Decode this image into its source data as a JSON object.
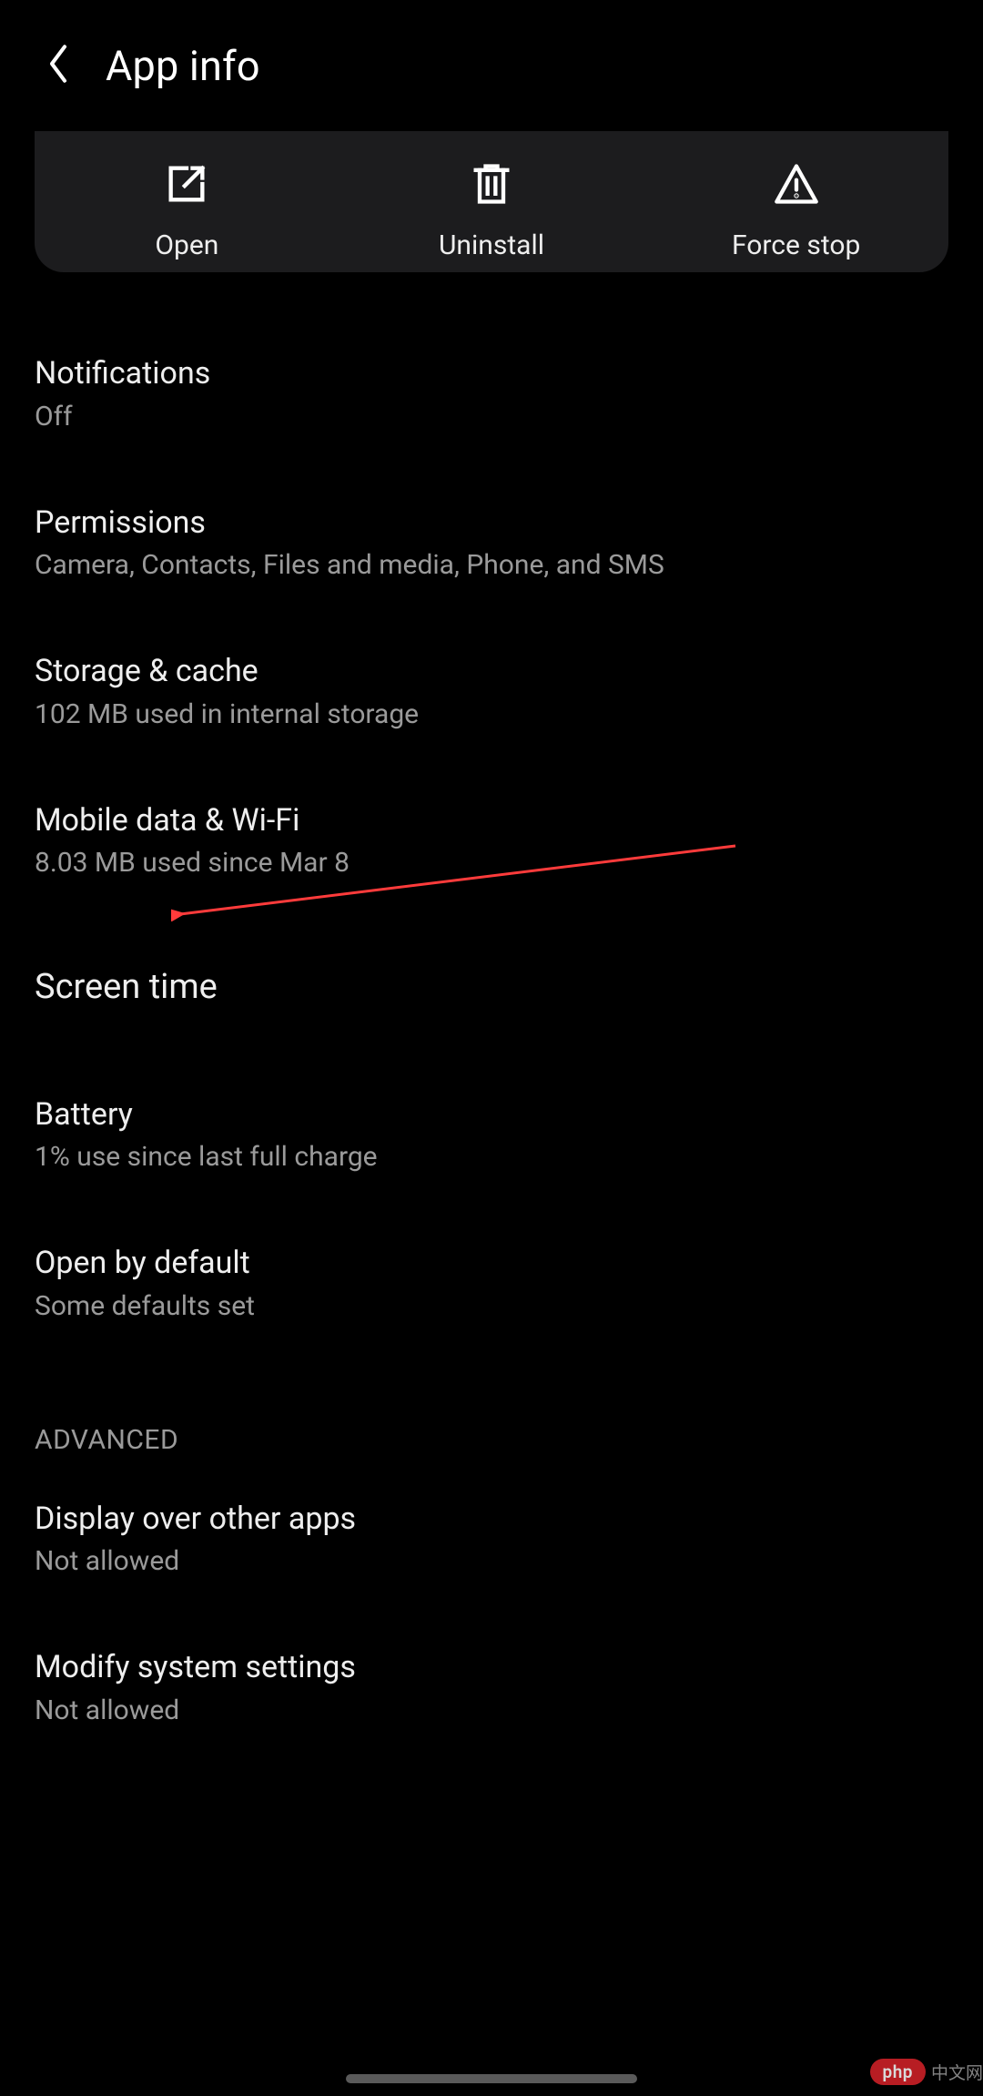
{
  "header": {
    "title": "App info"
  },
  "actions": {
    "open": "Open",
    "uninstall": "Uninstall",
    "force_stop": "Force stop"
  },
  "items": {
    "notifications": {
      "title": "Notifications",
      "sub": "Off"
    },
    "permissions": {
      "title": "Permissions",
      "sub": "Camera, Contacts, Files and media, Phone, and SMS"
    },
    "storage": {
      "title": "Storage & cache",
      "sub": "102 MB used in internal storage"
    },
    "mobile_data": {
      "title": "Mobile data & Wi-Fi",
      "sub": "8.03 MB used since Mar 8"
    },
    "screen_time": {
      "title": "Screen time"
    },
    "battery": {
      "title": "Battery",
      "sub": "1% use since last full charge"
    },
    "open_by_default": {
      "title": "Open by default",
      "sub": "Some defaults set"
    },
    "display_over": {
      "title": "Display over other apps",
      "sub": "Not allowed"
    },
    "modify_system": {
      "title": "Modify system settings",
      "sub": "Not allowed"
    }
  },
  "sections": {
    "advanced": "ADVANCED"
  },
  "watermark": {
    "pill": "php",
    "text": "中文网"
  },
  "annotation": {
    "color": "#ff3b3b",
    "target": "battery"
  }
}
